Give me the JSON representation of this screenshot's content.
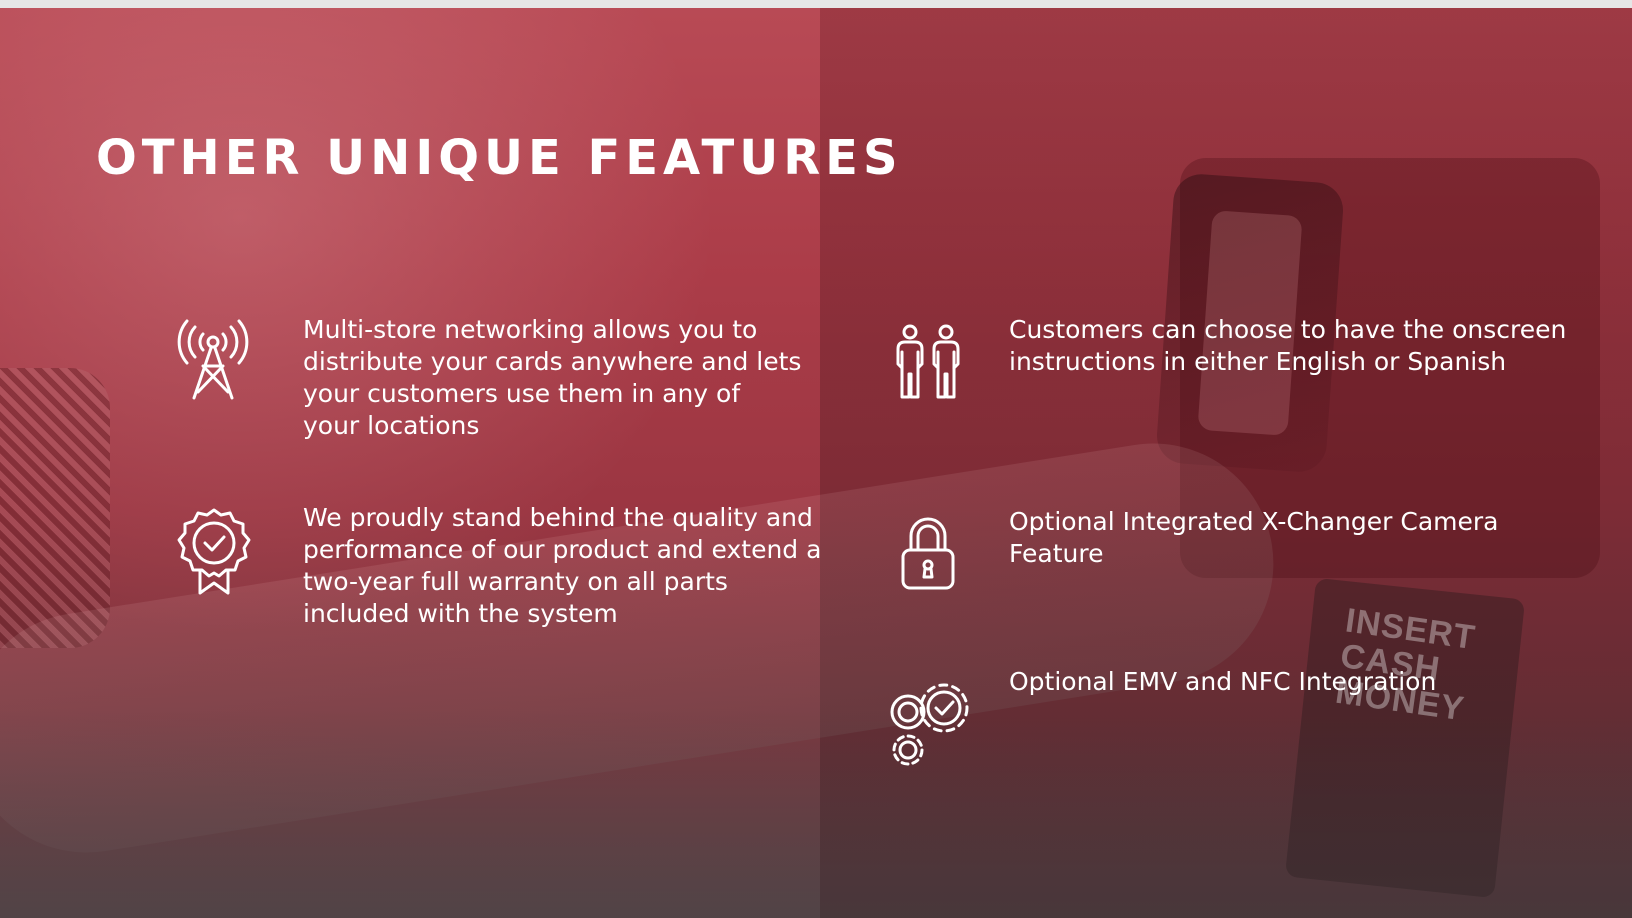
{
  "page": {
    "title": "OTHER UNIQUE FEATURES",
    "accent_color": "#a8323f",
    "text_color": "#ffffff"
  },
  "background": {
    "machine_label": "INSERT CASH MONEY"
  },
  "features": [
    {
      "icon": "antenna-tower-icon",
      "text": "Multi-store networking allows you to distribute your cards anywhere and lets your customers use them in any of your locations"
    },
    {
      "icon": "award-badge-icon",
      "text": "We proudly stand behind the quality and performance of our product and extend a two-year full warranty on all parts included with the system"
    },
    {
      "icon": "two-people-icon",
      "text": "Customers can choose to have the onscreen instructions in either English or Spanish"
    },
    {
      "icon": "padlock-icon",
      "text": "Optional Integrated X-Changer Camera Feature"
    },
    {
      "icon": "gears-check-icon",
      "text": "Optional EMV and NFC Integration"
    }
  ]
}
